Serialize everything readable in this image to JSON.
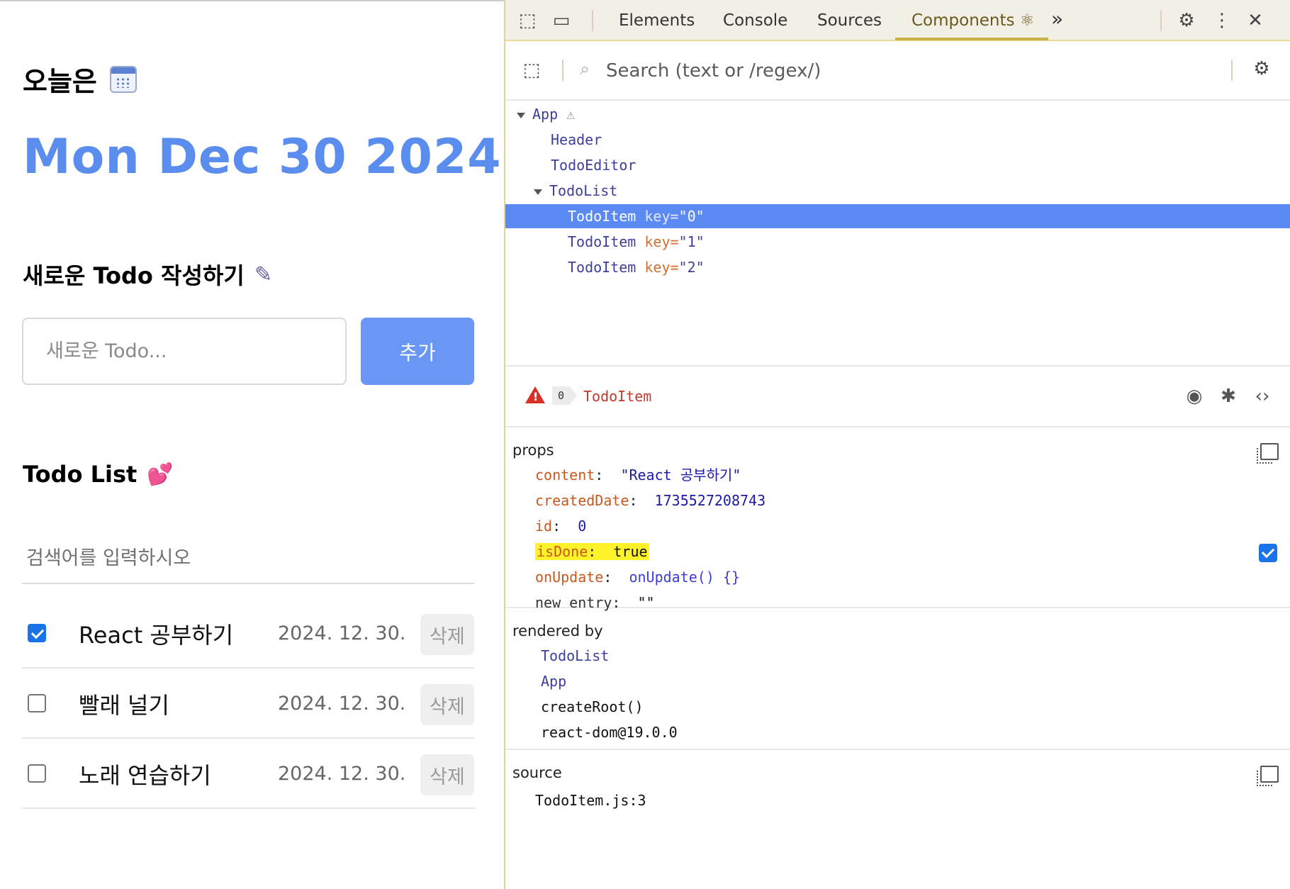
{
  "app": {
    "header": {
      "label": "오늘은",
      "icon": "calendar-icon",
      "date": "Mon Dec 30 2024"
    },
    "editor": {
      "title": "새로운 Todo 작성하기",
      "icon": "pen-icon",
      "placeholder": "새로운 Todo...",
      "add_label": "추가"
    },
    "list": {
      "title": "Todo List",
      "icon": "heart-icon",
      "search_placeholder": "검색어를 입력하시오",
      "items": [
        {
          "content": "React 공부하기",
          "date": "2024. 12. 30.",
          "done": true,
          "delete_label": "삭제"
        },
        {
          "content": "빨래 널기",
          "date": "2024. 12. 30.",
          "done": false,
          "delete_label": "삭제"
        },
        {
          "content": "노래 연습하기",
          "date": "2024. 12. 30.",
          "done": false,
          "delete_label": "삭제"
        }
      ]
    }
  },
  "devtools": {
    "tabs": [
      "Elements",
      "Console",
      "Sources",
      "Components ⚛",
      "»"
    ],
    "active_tab": "Components",
    "search_placeholder": "Search (text or /regex/)",
    "tree": [
      {
        "name": "App",
        "depth": 0,
        "expanded": true,
        "warning": true
      },
      {
        "name": "Header",
        "depth": 1
      },
      {
        "name": "TodoEditor",
        "depth": 1
      },
      {
        "name": "TodoList",
        "depth": 1,
        "expanded": true
      },
      {
        "name": "TodoItem",
        "key_label": "key=",
        "key": "\"0\"",
        "depth": 2,
        "selected": true
      },
      {
        "name": "TodoItem",
        "key_label": "key=",
        "key": "\"1\"",
        "depth": 2
      },
      {
        "name": "TodoItem",
        "key_label": "key=",
        "key": "\"2\"",
        "depth": 2
      }
    ],
    "selected": {
      "warning_count": "0",
      "component": "TodoItem"
    },
    "props": {
      "label": "props",
      "rows": [
        {
          "key": "content",
          "value": "\"React 공부하기\""
        },
        {
          "key": "createdDate",
          "value": "1735527208743"
        },
        {
          "key": "id",
          "value": "0"
        },
        {
          "key": "isDone",
          "value": "true"
        },
        {
          "key": "onUpdate",
          "value": "onUpdate() {}"
        },
        {
          "key": "new entry",
          "value": "\"\""
        }
      ],
      "colon": ":"
    },
    "rendered_by": {
      "label": "rendered by",
      "items": [
        "TodoList",
        "App",
        "createRoot()",
        "react-dom@19.0.0"
      ]
    },
    "source": {
      "label": "source",
      "file": "TodoItem.js:3"
    }
  },
  "colors": {
    "accent": "#5b8def",
    "add_button": "#6a96f5",
    "selected_row": "#5b8af3",
    "highlight": "#fff22a"
  }
}
